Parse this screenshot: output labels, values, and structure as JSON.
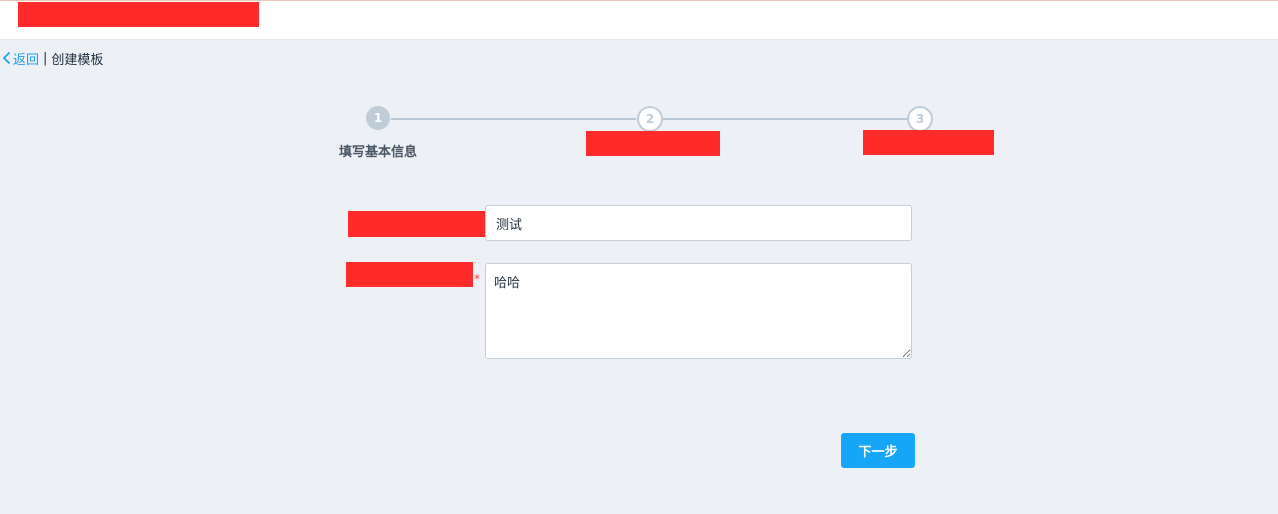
{
  "breadcrumb": {
    "back_label": "返回",
    "separator": "|",
    "current": "创建模板"
  },
  "steps": [
    {
      "number": "1",
      "title": "填写基本信息",
      "state": "active"
    },
    {
      "number": "2",
      "title": "",
      "state": "pending"
    },
    {
      "number": "3",
      "title": "",
      "state": "pending"
    }
  ],
  "form": {
    "name_value": "测试",
    "description_value": "哈哈",
    "required_mark": "*"
  },
  "actions": {
    "next_label": "下一步"
  },
  "colors": {
    "accent": "#17a5f7",
    "link": "#1a9cf0",
    "redaction": "#ff2a2a",
    "background": "#edf1f6"
  }
}
